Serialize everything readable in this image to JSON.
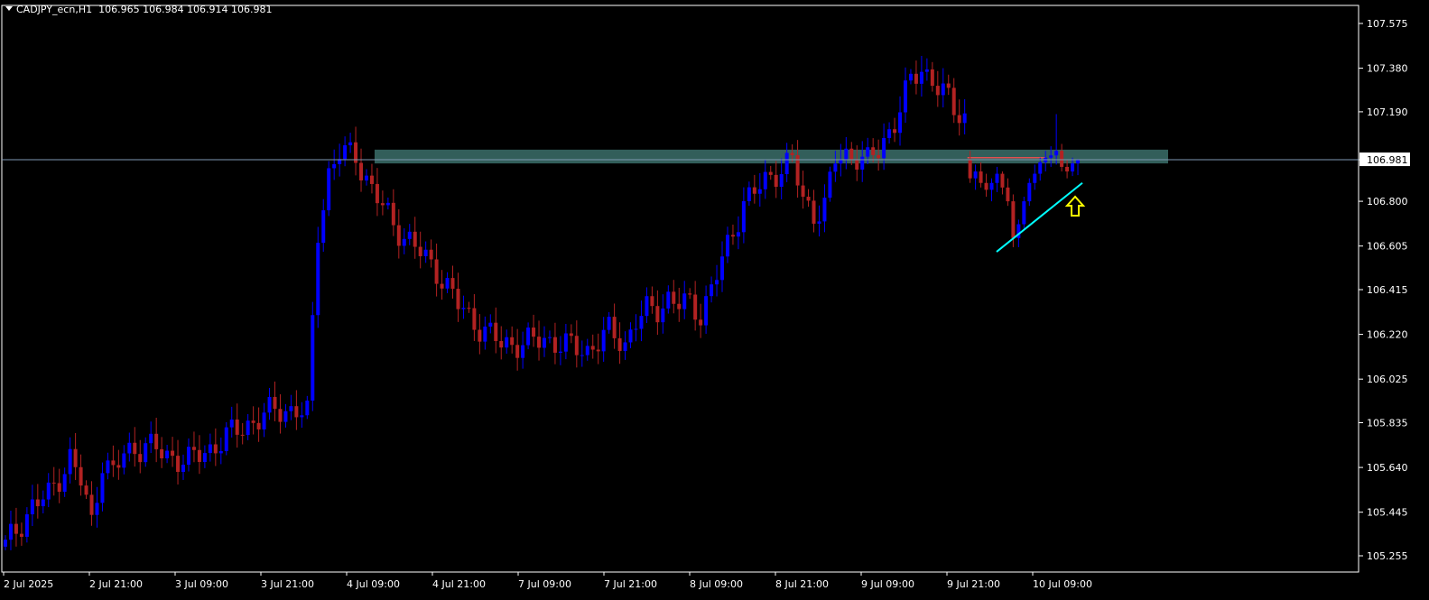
{
  "header": {
    "symbol": "CADJPY_ecn,H1",
    "ohlc": "106.965 106.984 106.914 106.981"
  },
  "colors": {
    "background": "#000000",
    "axis": "#ffffff",
    "bull": "#0000ff",
    "bear": "#b22222",
    "zone": "#3b6f6a",
    "trendline": "#00ffff",
    "price_line": "#7f99b3",
    "arrow": "#ffff00",
    "resistance": "#e05050"
  },
  "chart_data": {
    "type": "candlestick",
    "symbol": "CADJPY_ecn",
    "timeframe": "H1",
    "y_ticks": [
      "107.575",
      "107.380",
      "107.190",
      "106.981",
      "106.800",
      "106.605",
      "106.415",
      "106.220",
      "106.025",
      "105.835",
      "105.640",
      "105.445",
      "105.255"
    ],
    "ylim": [
      105.23,
      107.64
    ],
    "x_ticks": [
      "2 Jul 2025",
      "2 Jul 21:00",
      "3 Jul 09:00",
      "3 Jul 21:00",
      "4 Jul 09:00",
      "4 Jul 21:00",
      "7 Jul 09:00",
      "7 Jul 21:00",
      "8 Jul 09:00",
      "8 Jul 21:00",
      "9 Jul 09:00",
      "9 Jul 21:00",
      "10 Jul 09:00"
    ],
    "current_price": "106.981",
    "candle_count": 200,
    "anchors": [
      [
        0,
        105.3
      ],
      [
        5,
        105.47
      ],
      [
        8,
        105.52
      ],
      [
        10,
        105.6
      ],
      [
        12,
        105.68
      ],
      [
        14,
        105.58
      ],
      [
        16,
        105.4
      ],
      [
        18,
        105.67
      ],
      [
        20,
        105.61
      ],
      [
        22,
        105.7
      ],
      [
        26,
        105.74
      ],
      [
        30,
        105.69
      ],
      [
        34,
        105.67
      ],
      [
        38,
        105.72
      ],
      [
        42,
        105.79
      ],
      [
        46,
        105.84
      ],
      [
        50,
        105.89
      ],
      [
        54,
        105.89
      ],
      [
        56,
        105.87
      ],
      [
        58,
        106.67
      ],
      [
        60,
        106.92
      ],
      [
        62,
        107.01
      ],
      [
        65,
        107.0
      ],
      [
        68,
        106.85
      ],
      [
        72,
        106.7
      ],
      [
        76,
        106.6
      ],
      [
        80,
        106.5
      ],
      [
        84,
        106.35
      ],
      [
        88,
        106.25
      ],
      [
        92,
        106.18
      ],
      [
        96,
        106.18
      ],
      [
        100,
        106.2
      ],
      [
        104,
        106.17
      ],
      [
        108,
        106.15
      ],
      [
        112,
        106.23
      ],
      [
        115,
        106.18
      ],
      [
        117,
        106.28
      ],
      [
        119,
        106.32
      ],
      [
        121,
        106.33
      ],
      [
        123,
        106.38
      ],
      [
        125,
        106.35
      ],
      [
        127,
        106.35
      ],
      [
        129,
        106.31
      ],
      [
        131,
        106.42
      ],
      [
        134,
        106.6
      ],
      [
        137,
        106.8
      ],
      [
        140,
        106.86
      ],
      [
        143,
        106.93
      ],
      [
        146,
        106.98
      ],
      [
        148,
        106.8
      ],
      [
        150,
        106.75
      ],
      [
        152,
        106.78
      ],
      [
        154,
        106.98
      ],
      [
        156,
        107.0
      ],
      [
        158,
        107.0
      ],
      [
        160,
        106.97
      ],
      [
        162,
        107.02
      ],
      [
        165,
        107.15
      ],
      [
        168,
        107.32
      ],
      [
        170,
        107.38
      ],
      [
        172,
        107.33
      ],
      [
        174,
        107.27
      ],
      [
        176,
        107.2
      ],
      [
        178,
        107.17
      ],
      [
        180,
        107.21
      ],
      [
        182,
        107.29
      ],
      [
        184,
        107.4
      ],
      [
        186,
        107.45
      ],
      [
        188,
        107.52
      ],
      [
        190,
        107.53
      ],
      [
        192,
        107.48
      ],
      [
        194,
        107.34
      ],
      [
        196,
        107.24
      ]
    ],
    "candles_tail": [
      [
        106.98,
        107.02,
        106.88,
        106.9
      ],
      [
        106.9,
        106.96,
        106.85,
        106.93
      ],
      [
        106.93,
        106.97,
        106.86,
        106.88
      ],
      [
        106.88,
        106.92,
        106.82,
        106.85
      ],
      [
        106.85,
        106.9,
        106.8,
        106.88
      ],
      [
        106.88,
        106.95,
        106.84,
        106.92
      ],
      [
        106.92,
        106.93,
        106.83,
        106.86
      ],
      [
        106.86,
        106.9,
        106.78,
        106.8
      ],
      [
        106.8,
        106.83,
        106.6,
        106.64
      ],
      [
        106.64,
        106.72,
        106.6,
        106.7
      ],
      [
        106.7,
        106.82,
        106.68,
        106.8
      ],
      [
        106.8,
        106.9,
        106.78,
        106.88
      ],
      [
        106.88,
        106.96,
        106.85,
        106.92
      ],
      [
        106.92,
        106.99,
        106.89,
        106.97
      ],
      [
        106.97,
        107.02,
        106.93,
        106.99
      ],
      [
        106.99,
        107.04,
        106.95,
        107.0
      ],
      [
        107.0,
        107.18,
        106.96,
        107.02
      ],
      [
        107.02,
        107.05,
        106.93,
        106.95
      ],
      [
        106.95,
        106.98,
        106.9,
        106.93
      ],
      [
        106.93,
        106.99,
        106.91,
        106.965
      ],
      [
        106.965,
        106.984,
        106.914,
        106.981
      ]
    ],
    "zone": {
      "top": 107.025,
      "bottom": 106.965
    },
    "resistance_level": 106.99,
    "trendline": {
      "from": [
        106.58
      ],
      "to": [
        106.88
      ]
    }
  }
}
